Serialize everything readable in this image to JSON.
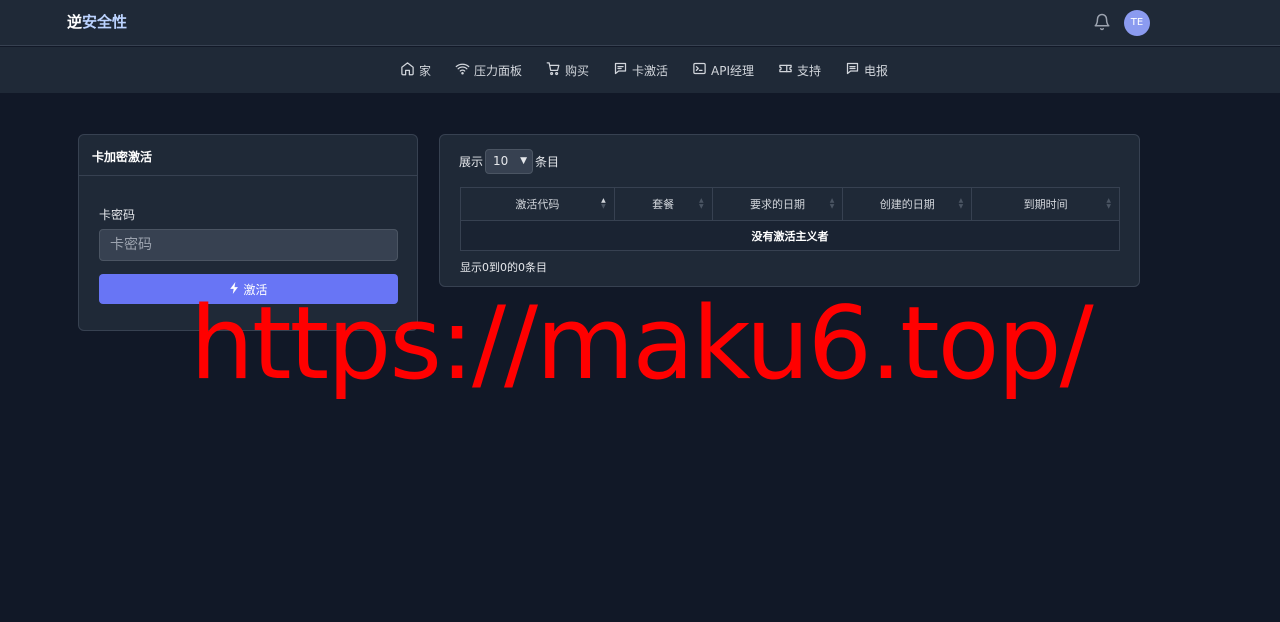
{
  "header": {
    "brand_part1": "逆",
    "brand_part2": "安全性",
    "avatar_initials": "TE"
  },
  "nav": {
    "items": [
      {
        "label": "家",
        "icon": "home-icon"
      },
      {
        "label": "压力面板",
        "icon": "wifi-icon"
      },
      {
        "label": "购买",
        "icon": "cart-icon"
      },
      {
        "label": "卡激活",
        "icon": "message-icon"
      },
      {
        "label": "API经理",
        "icon": "terminal-icon"
      },
      {
        "label": "支持",
        "icon": "ticket-icon"
      },
      {
        "label": "电报",
        "icon": "chat-icon"
      }
    ]
  },
  "activation": {
    "title": "卡加密激活",
    "field_label": "卡密码",
    "placeholder": "卡密码",
    "button_label": "激活",
    "button_color": "#6875f5"
  },
  "table": {
    "show_prefix": "展示",
    "page_size": "10",
    "show_suffix": "条目",
    "columns": [
      "激活代码",
      "套餐",
      "要求的日期",
      "创建的日期",
      "到期时间"
    ],
    "empty_message": "没有激活主义者",
    "info": "显示0到0的0条目"
  },
  "watermark": {
    "text": "https://maku6.top/",
    "color": "#ff0000"
  }
}
